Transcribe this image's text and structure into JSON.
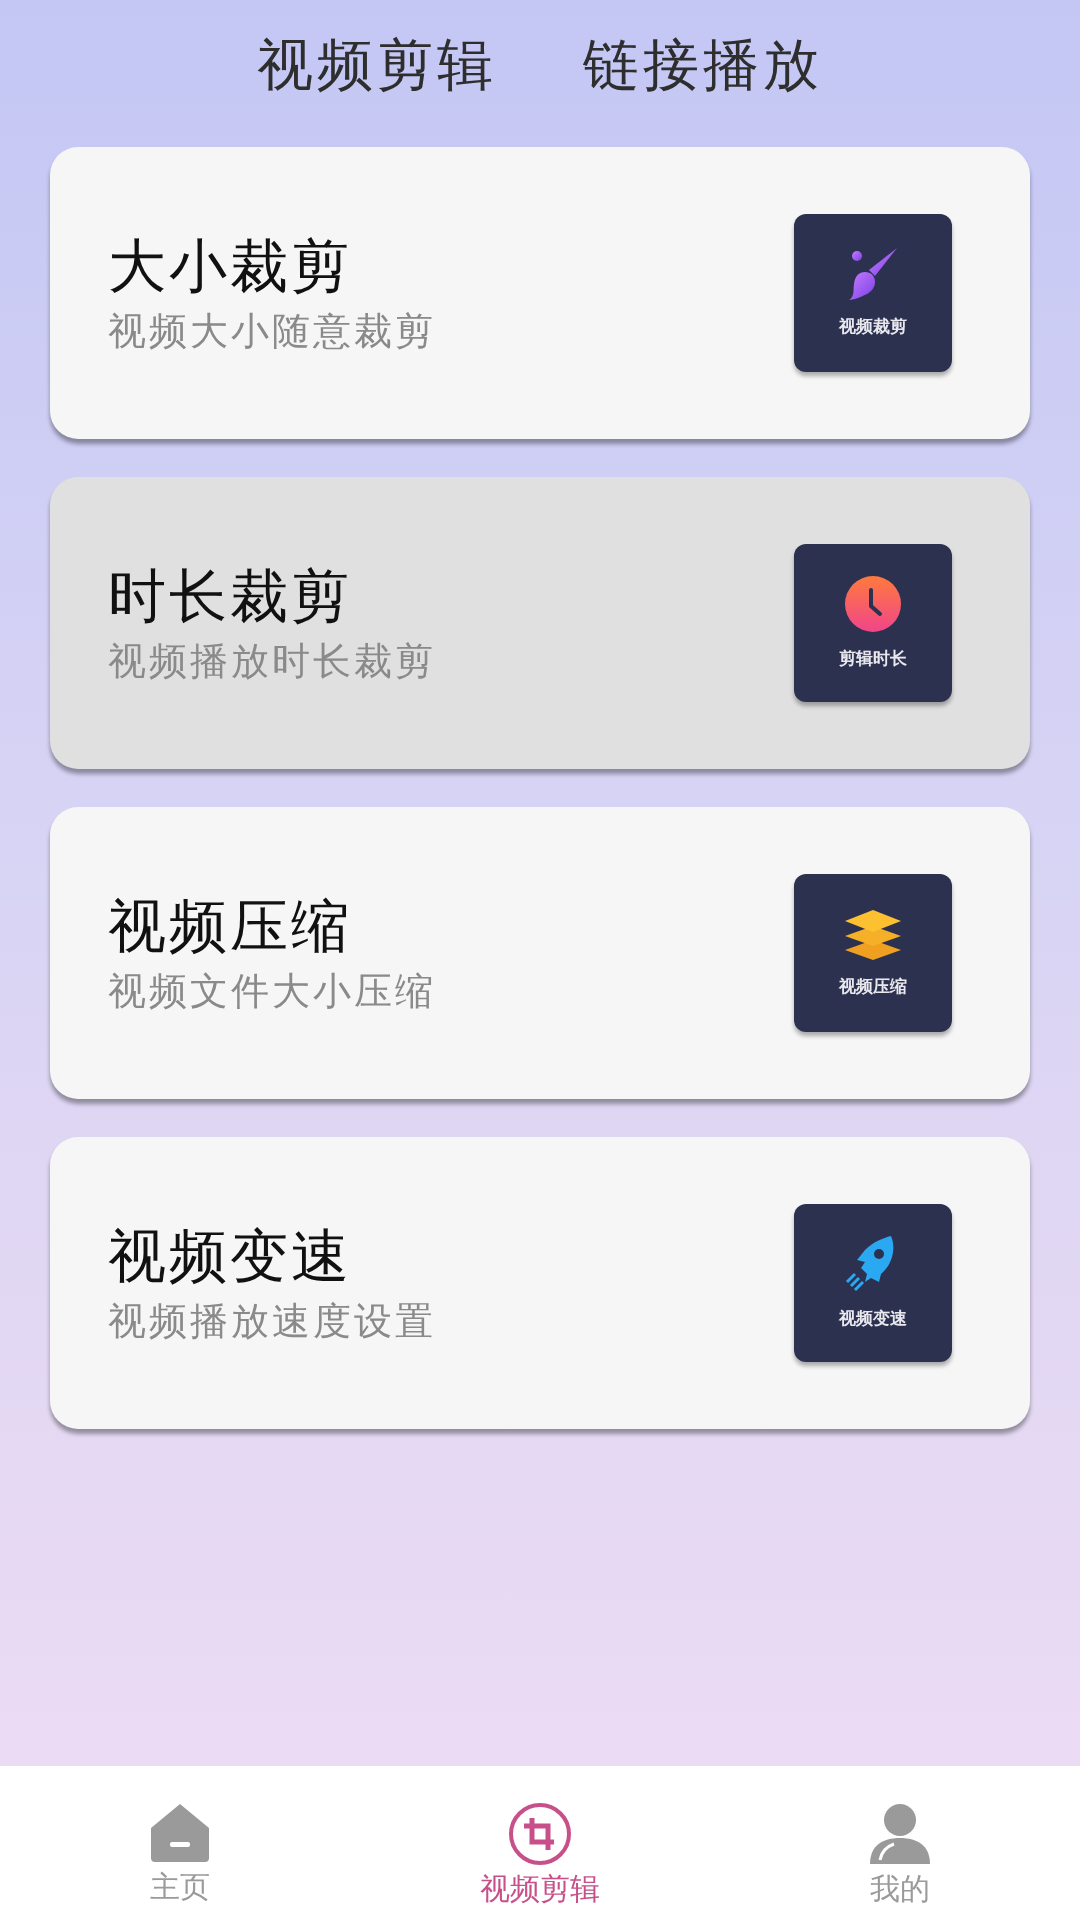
{
  "top_tabs": [
    {
      "label": "视频剪辑"
    },
    {
      "label": "链接播放"
    }
  ],
  "cards": [
    {
      "title": "大小裁剪",
      "subtitle": "视频大小随意裁剪",
      "tile_label": "视频裁剪",
      "kind": "brush",
      "selected": false
    },
    {
      "title": "时长裁剪",
      "subtitle": "视频播放时长裁剪",
      "tile_label": "剪辑时长",
      "kind": "clock",
      "selected": true
    },
    {
      "title": "视频压缩",
      "subtitle": "视频文件大小压缩",
      "tile_label": "视频压缩",
      "kind": "layers",
      "selected": false
    },
    {
      "title": "视频变速",
      "subtitle": "视频播放速度设置",
      "tile_label": "视频变速",
      "kind": "rocket",
      "selected": false
    }
  ],
  "bottom_nav": [
    {
      "label": "主页",
      "kind": "home",
      "selected": false
    },
    {
      "label": "视频剪辑",
      "kind": "crop",
      "selected": true
    },
    {
      "label": "我的",
      "kind": "person",
      "selected": false
    }
  ]
}
